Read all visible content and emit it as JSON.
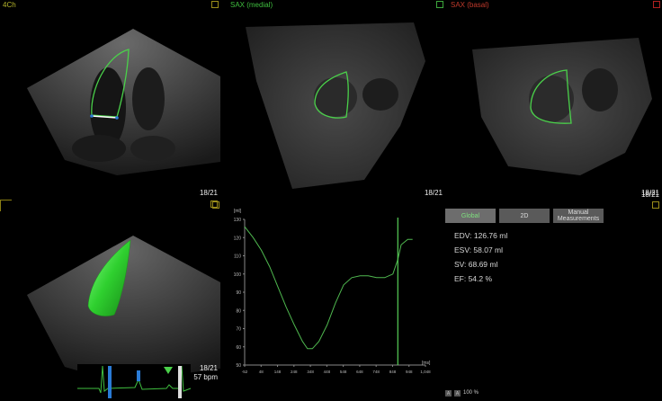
{
  "views": {
    "four_chamber": {
      "title": "4Ch",
      "title_color": "#b7b72c",
      "frame": "18/21",
      "bpm": "57 bpm"
    },
    "sax_medial": {
      "title": "SAX (medial)",
      "title_color": "#3fbf3f",
      "frame": "18/21"
    },
    "sax_basal": {
      "title": "SAX (basal)",
      "title_color": "#c0392b",
      "frame": "18/21"
    },
    "volume_3d": {
      "frame": "18/21",
      "bpm": "57 bpm"
    }
  },
  "tabs": [
    {
      "label": "Global",
      "active": true
    },
    {
      "label": "2D",
      "active": false
    },
    {
      "label": "Manual Measurements",
      "active": false
    }
  ],
  "metrics": {
    "edv": "EDV: 126.76 ml",
    "esv": "ESV: 58.07 ml",
    "sv": "SV: 68.69 ml",
    "ef": "EF: 54.2 %"
  },
  "zoom": {
    "minus": "A",
    "plus": "A",
    "level": "100 %"
  },
  "chart_data": {
    "type": "line",
    "title": "",
    "ylabel": "[ml]",
    "xlabel": "[ms]",
    "ylim": [
      50,
      130
    ],
    "xlim": [
      -52,
      1048
    ],
    "yticks": [
      "130",
      "120",
      "110",
      "100",
      "90",
      "80",
      "70",
      "60",
      "50"
    ],
    "xticks": [
      "-52",
      "48",
      "148",
      "248",
      "348",
      "448",
      "548",
      "648",
      "748",
      "848",
      "948",
      "1,048"
    ],
    "series": [
      {
        "color": "#4fb84f",
        "x": [
          -52,
          0,
          50,
          100,
          150,
          200,
          250,
          300,
          330,
          360,
          400,
          450,
          500,
          550,
          600,
          650,
          700,
          750,
          800,
          850,
          880,
          900,
          940,
          970
        ],
        "y": [
          126,
          120,
          113,
          104,
          93,
          82,
          72,
          63,
          59,
          59,
          63,
          72,
          84,
          94,
          98,
          99,
          99,
          98,
          98,
          100,
          108,
          116,
          119,
          119
        ]
      }
    ],
    "marker_x": 880,
    "marker_color": "#58d058"
  },
  "colors": {
    "accent_green": "#3fbf3f",
    "olive": "#9a8d1a"
  }
}
